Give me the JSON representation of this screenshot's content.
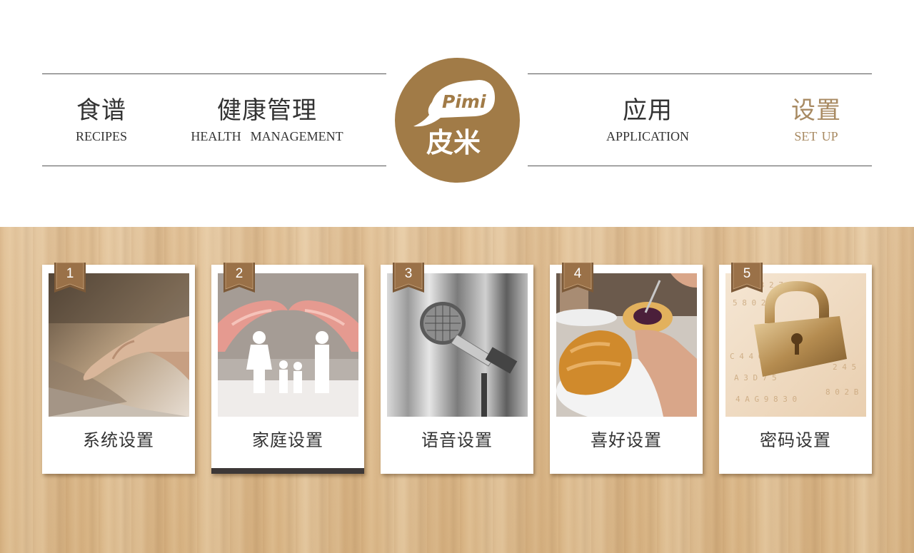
{
  "nav": {
    "recipes": {
      "zh": "食谱",
      "en": "RECIPES"
    },
    "health": {
      "zh": "健康管理",
      "en": "HEALTH  MANAGEMENT"
    },
    "application": {
      "zh": "应用",
      "en": "APPLICATION"
    },
    "setup": {
      "zh": "设置",
      "en": "SET UP",
      "active": true
    }
  },
  "logo": {
    "en": "Pimi",
    "zh": "皮米"
  },
  "colors": {
    "brand": "#a17b47",
    "active_nav": "#a88a62",
    "text": "#333333",
    "selected_bar": "#3d3837"
  },
  "cards": [
    {
      "number": "1",
      "label": "系统设置",
      "image": "hand-touching-tablet"
    },
    {
      "number": "2",
      "label": "家庭设置",
      "image": "hands-over-paper-family",
      "selected": true
    },
    {
      "number": "3",
      "label": "语音设置",
      "image": "microphone-on-stand"
    },
    {
      "number": "4",
      "label": "喜好设置",
      "image": "croissant-breakfast"
    },
    {
      "number": "5",
      "label": "密码设置",
      "image": "golden-padlock-with-numbers"
    }
  ]
}
